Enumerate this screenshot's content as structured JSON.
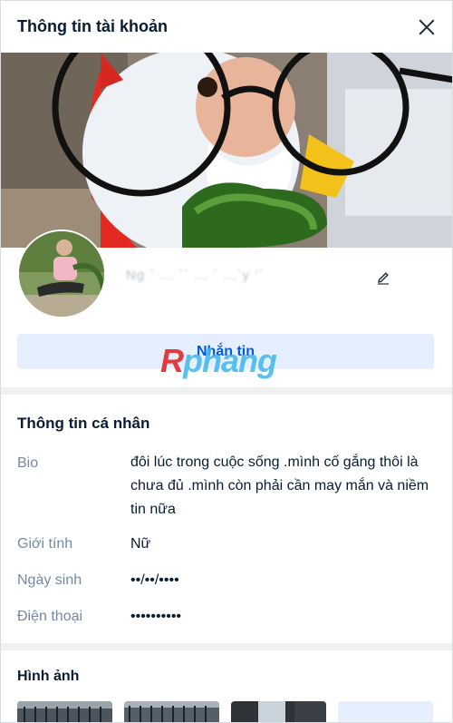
{
  "header": {
    "title": "Thông tin tài khoản"
  },
  "profile": {
    "display_name": "Ng ` ... `´ ... ` ...`y ’`",
    "message_label": "Nhắn tin"
  },
  "watermark": {
    "first": "R",
    "rest": "phang"
  },
  "personal": {
    "title": "Thông tin cá nhân",
    "bio_label": "Bio",
    "bio_value": "đôi lúc trong cuộc sống .mình cố gắng thôi là chưa đủ .mình còn phải cần may mắn và niềm tin nữa",
    "gender_label": "Giới tính",
    "gender_value": "Nữ",
    "birthday_label": "Ngày sinh",
    "birthday_value": "••/••/••••",
    "phone_label": "Điện thoại",
    "phone_value": "••••••••••"
  },
  "media": {
    "title": "Hình ảnh"
  },
  "colors": {
    "accent": "#005ae0",
    "button_bg": "#e5efff",
    "label": "#7589a3"
  }
}
